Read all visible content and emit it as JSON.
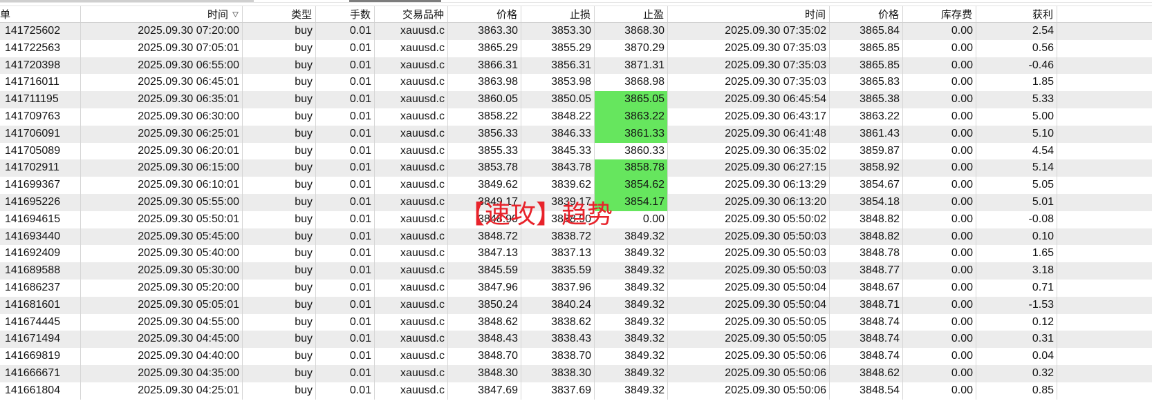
{
  "colors": {
    "row_stripe": "#ececec",
    "tp_hit_highlight": "#66e65e",
    "watermark": "#e8232b"
  },
  "header": {
    "columns": [
      {
        "label": "单"
      },
      {
        "label": "时间",
        "icon": "sort-descending-icon"
      },
      {
        "label": "类型"
      },
      {
        "label": "手数"
      },
      {
        "label": "交易品种"
      },
      {
        "label": "价格"
      },
      {
        "label": "止损"
      },
      {
        "label": "止盈"
      },
      {
        "label": "时间"
      },
      {
        "label": "价格"
      },
      {
        "label": "库存费"
      },
      {
        "label": "获利"
      }
    ]
  },
  "rows": [
    {
      "ticket": "141725602",
      "open_time": "2025.09.30 07:20:00",
      "type": "buy",
      "volume": "0.01",
      "symbol": "xauusd.c",
      "open_price": "3863.30",
      "sl": "3853.30",
      "tp": "3868.30",
      "tp_hit": false,
      "close_time": "2025.09.30 07:35:02",
      "close_price": "3865.84",
      "swap": "0.00",
      "profit": "2.54"
    },
    {
      "ticket": "141722563",
      "open_time": "2025.09.30 07:05:01",
      "type": "buy",
      "volume": "0.01",
      "symbol": "xauusd.c",
      "open_price": "3865.29",
      "sl": "3855.29",
      "tp": "3870.29",
      "tp_hit": false,
      "close_time": "2025.09.30 07:35:03",
      "close_price": "3865.85",
      "swap": "0.00",
      "profit": "0.56"
    },
    {
      "ticket": "141720398",
      "open_time": "2025.09.30 06:55:00",
      "type": "buy",
      "volume": "0.01",
      "symbol": "xauusd.c",
      "open_price": "3866.31",
      "sl": "3856.31",
      "tp": "3871.31",
      "tp_hit": false,
      "close_time": "2025.09.30 07:35:03",
      "close_price": "3865.85",
      "swap": "0.00",
      "profit": "-0.46"
    },
    {
      "ticket": "141716011",
      "open_time": "2025.09.30 06:45:01",
      "type": "buy",
      "volume": "0.01",
      "symbol": "xauusd.c",
      "open_price": "3863.98",
      "sl": "3853.98",
      "tp": "3868.98",
      "tp_hit": false,
      "close_time": "2025.09.30 07:35:03",
      "close_price": "3865.83",
      "swap": "0.00",
      "profit": "1.85"
    },
    {
      "ticket": "141711195",
      "open_time": "2025.09.30 06:35:01",
      "type": "buy",
      "volume": "0.01",
      "symbol": "xauusd.c",
      "open_price": "3860.05",
      "sl": "3850.05",
      "tp": "3865.05",
      "tp_hit": true,
      "close_time": "2025.09.30 06:45:54",
      "close_price": "3865.38",
      "swap": "0.00",
      "profit": "5.33"
    },
    {
      "ticket": "141709763",
      "open_time": "2025.09.30 06:30:00",
      "type": "buy",
      "volume": "0.01",
      "symbol": "xauusd.c",
      "open_price": "3858.22",
      "sl": "3848.22",
      "tp": "3863.22",
      "tp_hit": true,
      "close_time": "2025.09.30 06:43:17",
      "close_price": "3863.22",
      "swap": "0.00",
      "profit": "5.00"
    },
    {
      "ticket": "141706091",
      "open_time": "2025.09.30 06:25:01",
      "type": "buy",
      "volume": "0.01",
      "symbol": "xauusd.c",
      "open_price": "3856.33",
      "sl": "3846.33",
      "tp": "3861.33",
      "tp_hit": true,
      "close_time": "2025.09.30 06:41:48",
      "close_price": "3861.43",
      "swap": "0.00",
      "profit": "5.10"
    },
    {
      "ticket": "141705089",
      "open_time": "2025.09.30 06:20:01",
      "type": "buy",
      "volume": "0.01",
      "symbol": "xauusd.c",
      "open_price": "3855.33",
      "sl": "3845.33",
      "tp": "3860.33",
      "tp_hit": false,
      "close_time": "2025.09.30 06:35:02",
      "close_price": "3859.87",
      "swap": "0.00",
      "profit": "4.54"
    },
    {
      "ticket": "141702911",
      "open_time": "2025.09.30 06:15:00",
      "type": "buy",
      "volume": "0.01",
      "symbol": "xauusd.c",
      "open_price": "3853.78",
      "sl": "3843.78",
      "tp": "3858.78",
      "tp_hit": true,
      "close_time": "2025.09.30 06:27:15",
      "close_price": "3858.92",
      "swap": "0.00",
      "profit": "5.14"
    },
    {
      "ticket": "141699367",
      "open_time": "2025.09.30 06:10:01",
      "type": "buy",
      "volume": "0.01",
      "symbol": "xauusd.c",
      "open_price": "3849.62",
      "sl": "3839.62",
      "tp": "3854.62",
      "tp_hit": true,
      "close_time": "2025.09.30 06:13:29",
      "close_price": "3854.67",
      "swap": "0.00",
      "profit": "5.05"
    },
    {
      "ticket": "141695226",
      "open_time": "2025.09.30 05:55:00",
      "type": "buy",
      "volume": "0.01",
      "symbol": "xauusd.c",
      "open_price": "3849.17",
      "sl": "3839.17",
      "tp": "3854.17",
      "tp_hit": true,
      "close_time": "2025.09.30 06:13:20",
      "close_price": "3854.18",
      "swap": "0.00",
      "profit": "5.01"
    },
    {
      "ticket": "141694615",
      "open_time": "2025.09.30 05:50:01",
      "type": "buy",
      "volume": "0.01",
      "symbol": "xauusd.c",
      "open_price": "3848.90",
      "sl": "3838.90",
      "tp": "0.00",
      "tp_hit": false,
      "close_time": "2025.09.30 05:50:02",
      "close_price": "3848.82",
      "swap": "0.00",
      "profit": "-0.08"
    },
    {
      "ticket": "141693440",
      "open_time": "2025.09.30 05:45:00",
      "type": "buy",
      "volume": "0.01",
      "symbol": "xauusd.c",
      "open_price": "3848.72",
      "sl": "3838.72",
      "tp": "3849.32",
      "tp_hit": false,
      "close_time": "2025.09.30 05:50:03",
      "close_price": "3848.82",
      "swap": "0.00",
      "profit": "0.10"
    },
    {
      "ticket": "141692409",
      "open_time": "2025.09.30 05:40:00",
      "type": "buy",
      "volume": "0.01",
      "symbol": "xauusd.c",
      "open_price": "3847.13",
      "sl": "3837.13",
      "tp": "3849.32",
      "tp_hit": false,
      "close_time": "2025.09.30 05:50:03",
      "close_price": "3848.78",
      "swap": "0.00",
      "profit": "1.65"
    },
    {
      "ticket": "141689588",
      "open_time": "2025.09.30 05:30:00",
      "type": "buy",
      "volume": "0.01",
      "symbol": "xauusd.c",
      "open_price": "3845.59",
      "sl": "3835.59",
      "tp": "3849.32",
      "tp_hit": false,
      "close_time": "2025.09.30 05:50:03",
      "close_price": "3848.77",
      "swap": "0.00",
      "profit": "3.18"
    },
    {
      "ticket": "141686237",
      "open_time": "2025.09.30 05:20:00",
      "type": "buy",
      "volume": "0.01",
      "symbol": "xauusd.c",
      "open_price": "3847.96",
      "sl": "3837.96",
      "tp": "3849.32",
      "tp_hit": false,
      "close_time": "2025.09.30 05:50:04",
      "close_price": "3848.67",
      "swap": "0.00",
      "profit": "0.71"
    },
    {
      "ticket": "141681601",
      "open_time": "2025.09.30 05:05:01",
      "type": "buy",
      "volume": "0.01",
      "symbol": "xauusd.c",
      "open_price": "3850.24",
      "sl": "3840.24",
      "tp": "3849.32",
      "tp_hit": false,
      "close_time": "2025.09.30 05:50:04",
      "close_price": "3848.71",
      "swap": "0.00",
      "profit": "-1.53"
    },
    {
      "ticket": "141674445",
      "open_time": "2025.09.30 04:55:00",
      "type": "buy",
      "volume": "0.01",
      "symbol": "xauusd.c",
      "open_price": "3848.62",
      "sl": "3838.62",
      "tp": "3849.32",
      "tp_hit": false,
      "close_time": "2025.09.30 05:50:05",
      "close_price": "3848.74",
      "swap": "0.00",
      "profit": "0.12"
    },
    {
      "ticket": "141671494",
      "open_time": "2025.09.30 04:45:00",
      "type": "buy",
      "volume": "0.01",
      "symbol": "xauusd.c",
      "open_price": "3848.43",
      "sl": "3838.43",
      "tp": "3849.32",
      "tp_hit": false,
      "close_time": "2025.09.30 05:50:05",
      "close_price": "3848.74",
      "swap": "0.00",
      "profit": "0.31"
    },
    {
      "ticket": "141669819",
      "open_time": "2025.09.30 04:40:00",
      "type": "buy",
      "volume": "0.01",
      "symbol": "xauusd.c",
      "open_price": "3848.70",
      "sl": "3838.70",
      "tp": "3849.32",
      "tp_hit": false,
      "close_time": "2025.09.30 05:50:06",
      "close_price": "3848.74",
      "swap": "0.00",
      "profit": "0.04"
    },
    {
      "ticket": "141666671",
      "open_time": "2025.09.30 04:35:00",
      "type": "buy",
      "volume": "0.01",
      "symbol": "xauusd.c",
      "open_price": "3848.30",
      "sl": "3838.30",
      "tp": "3849.32",
      "tp_hit": false,
      "close_time": "2025.09.30 05:50:06",
      "close_price": "3848.62",
      "swap": "0.00",
      "profit": "0.32"
    },
    {
      "ticket": "141661804",
      "open_time": "2025.09.30 04:25:01",
      "type": "buy",
      "volume": "0.01",
      "symbol": "xauusd.c",
      "open_price": "3847.69",
      "sl": "3837.69",
      "tp": "3849.32",
      "tp_hit": false,
      "close_time": "2025.09.30 05:50:06",
      "close_price": "3848.54",
      "swap": "0.00",
      "profit": "0.85"
    }
  ],
  "watermark": "【速攻】趋势"
}
